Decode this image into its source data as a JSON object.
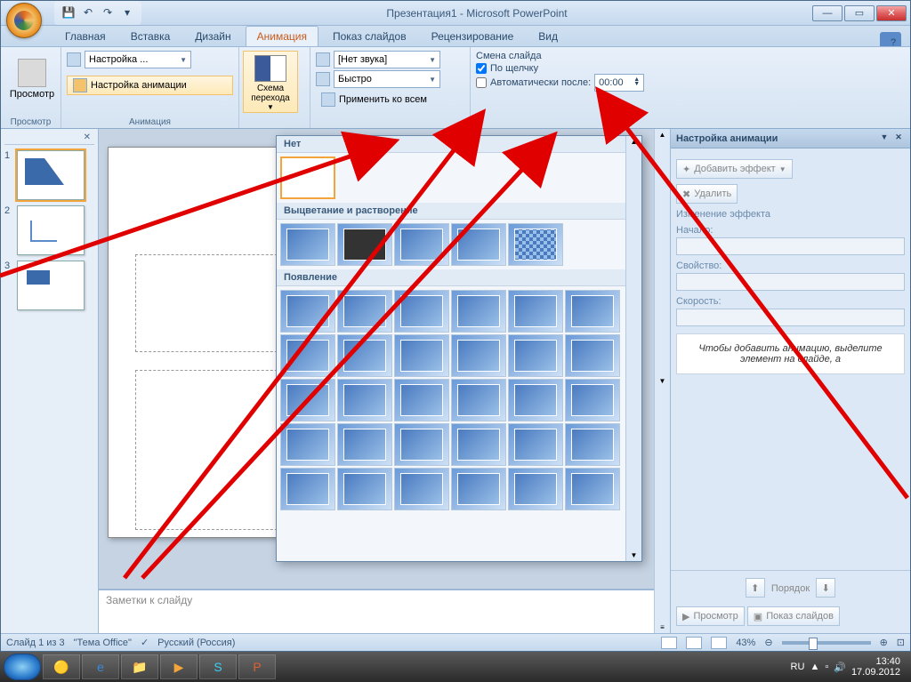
{
  "window": {
    "title": "Презентация1 - Microsoft PowerPoint"
  },
  "tabs": {
    "home": "Главная",
    "insert": "Вставка",
    "design": "Дизайн",
    "animation": "Анимация",
    "slideshow": "Показ слайдов",
    "review": "Рецензирование",
    "view": "Вид"
  },
  "ribbon": {
    "preview": "Просмотр",
    "preview_group": "Просмотр",
    "custom": "Настройка ...",
    "custom_anim": "Настройка анимации",
    "animation_group": "Анимация",
    "scheme": "Схема перехода",
    "sound": "[Нет звука]",
    "speed": "Быстро",
    "apply_all": "Применить ко всем",
    "advance_title": "Смена слайда",
    "on_click": "По щелчку",
    "auto_after": "Автоматически после:",
    "auto_time": "00:00"
  },
  "gallery": {
    "none": "Нет",
    "fade": "Выцветание и растворение",
    "wipe": "Появление"
  },
  "taskpane": {
    "title": "Настройка анимации",
    "add_effect": "Добавить эффект",
    "remove": "Удалить",
    "change": "Изменение эффекта",
    "start": "Начало:",
    "property": "Свойство:",
    "speed": "Скорость:",
    "info": "Чтобы добавить анимацию, выделите элемент на слайде, а",
    "order": "Порядок",
    "preview": "Просмотр",
    "slideshow": "Показ слайдов"
  },
  "notes": "Заметки к слайду",
  "status": {
    "slide": "Слайд 1 из 3",
    "theme": "\"Тема Office\"",
    "lang": "Русский (Россия)",
    "zoom": "43%"
  },
  "taskbar": {
    "lang": "RU",
    "time": "13:40",
    "date": "17.09.2012"
  }
}
